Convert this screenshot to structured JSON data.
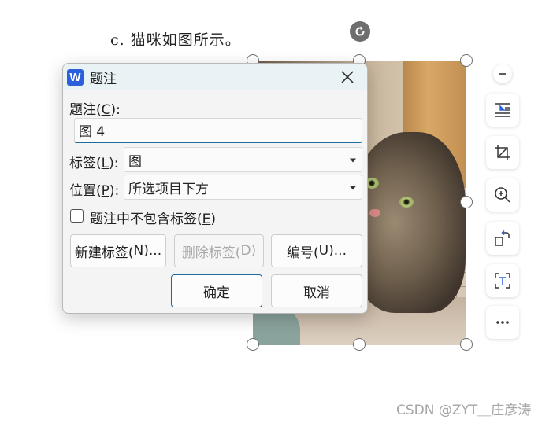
{
  "document": {
    "line_text": "c.  猫咪如图所示。"
  },
  "dialog": {
    "app_icon_letter": "W",
    "title": "题注",
    "caption_label": "题注(C):",
    "caption_label_pre": "题注(",
    "caption_label_key": "C",
    "caption_label_post": "):",
    "caption_value": "图 4",
    "tag_label_pre": "标签(",
    "tag_label_key": "L",
    "tag_label_post": "):",
    "tag_value": "图",
    "position_label_pre": "位置(",
    "position_label_key": "P",
    "position_label_post": "):",
    "position_value": "所选项目下方",
    "exclude_label_pre": "题注中不包含标签(",
    "exclude_label_key": "E",
    "exclude_label_post": ")",
    "exclude_checked": false,
    "new_label_pre": "新建标签(",
    "new_label_key": "N",
    "new_label_post": ")...",
    "delete_label_pre": "删除标签(",
    "delete_label_key": "D",
    "delete_label_post": ")",
    "numbering_pre": "编号(",
    "numbering_key": "U",
    "numbering_post": ")...",
    "ok_label": "确定",
    "cancel_label": "取消"
  },
  "image_toolbar": {
    "items": [
      "collapse-icon",
      "wrap-text-icon",
      "crop-icon",
      "zoom-in-icon",
      "rotate-icon",
      "extract-text-icon",
      "more-icon"
    ]
  },
  "colors": {
    "accent": "#1d6a9f",
    "app_icon": "#2b5fdb",
    "titlebar": "#e9f3f6"
  },
  "watermark": "CSDN @ZYT＿庄彦涛"
}
